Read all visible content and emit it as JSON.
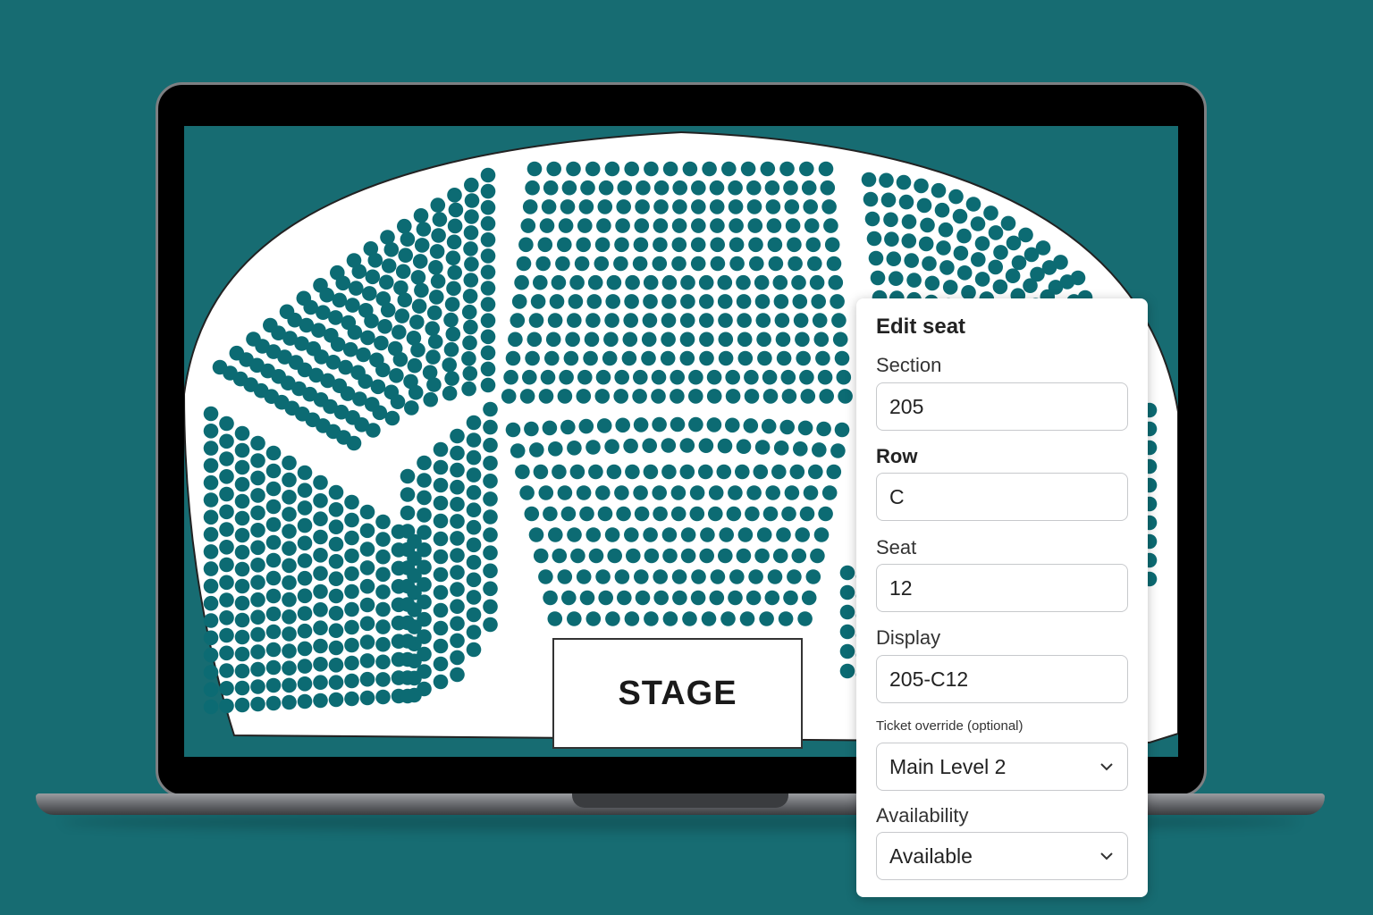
{
  "seat_map": {
    "stage_label": "STAGE",
    "seat_color": "#0c6b73",
    "background_color": "#176c72"
  },
  "edit_panel": {
    "title": "Edit seat",
    "section": {
      "label": "Section",
      "value": "205"
    },
    "row": {
      "label": "Row",
      "value": "C"
    },
    "seat": {
      "label": "Seat",
      "value": "12"
    },
    "display": {
      "label": "Display",
      "value": "205-C12"
    },
    "ticket_override": {
      "label": "Ticket override (optional)",
      "selected": "Main Level 2",
      "icon": "chevron-down-icon"
    },
    "availability": {
      "label": "Availability",
      "selected": "Available",
      "icon": "chevron-down-icon"
    }
  }
}
